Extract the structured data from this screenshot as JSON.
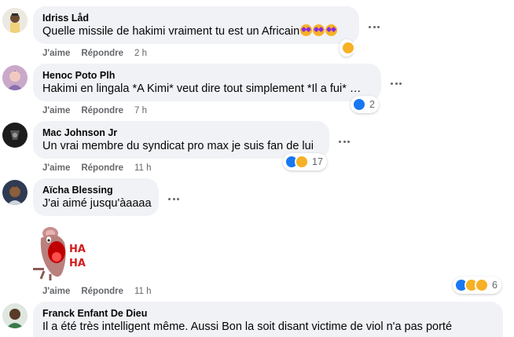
{
  "comments": [
    {
      "author": "Idriss Låd",
      "text": "Quelle missile de hakimi vraiment tu est un Africain",
      "like_label": "J'aime",
      "reply_label": "Répondre",
      "time": "2 h"
    },
    {
      "author": "Henoc Poto Plh",
      "text": "Hakimi en lingala *A Kimi* veut dire tout simplement *Il a fui* …",
      "like_label": "J'aime",
      "reply_label": "Répondre",
      "time": "7 h",
      "reaction_count": "2"
    },
    {
      "author": "Mac Johnson Jr",
      "text": "Un vrai membre du syndicat pro max je suis fan de lui",
      "like_label": "J'aime",
      "reply_label": "Répondre",
      "time": "11 h",
      "reaction_count": "17"
    },
    {
      "author": "Aïcha Blessing",
      "text": "J'ai aimé jusqu'àaaaa",
      "like_label": "J'aime",
      "reply_label": "Répondre",
      "time": "11 h",
      "reaction_count": "6",
      "sticker_text": "HA HA"
    },
    {
      "author": "Franck Enfant De Dieu",
      "text": "Il a été très intelligent même. Aussi Bon la soit disant victime de viol n'a pas porté"
    }
  ],
  "reaction_icons": [
    "like-icon",
    "haha-icon",
    "wow-icon"
  ],
  "colors": {
    "like": "#1877f2",
    "haha": "#f7b125",
    "bubble": "#f0f2f5",
    "meta": "#65676b"
  }
}
